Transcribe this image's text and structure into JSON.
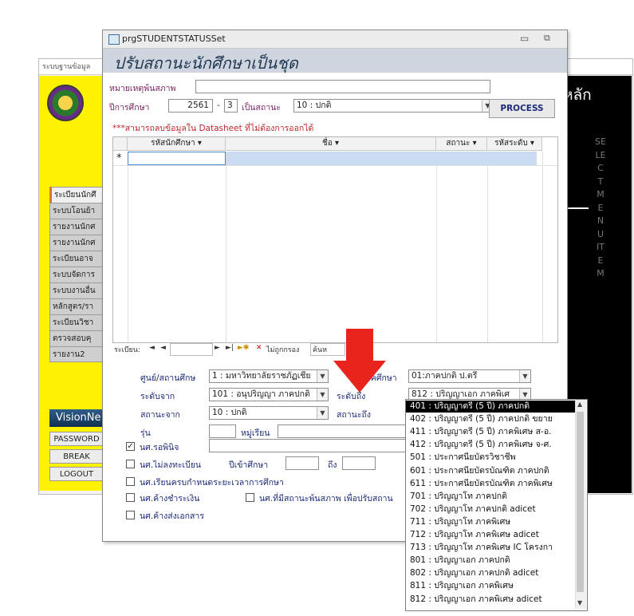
{
  "background_window": {
    "title": "ระบบฐานข้อมูล",
    "menu_items": [
      "ระเบียนนักศึ",
      "ระบบโอนย้า",
      "รายงานนักศ",
      "รายงานนักศ",
      "ระเบียนอาจ",
      "ระบบจัดการ",
      "ระบบงานอื่น",
      "หลักสูตร/รา",
      "ระเบียนวิชา",
      "ตรวจสอบคุ",
      "รายงาน2"
    ],
    "vision_label": "VisionNe",
    "buttons": {
      "password": "PASSWORD",
      "break": "BREAK",
      "logout": "LOGOUT"
    },
    "main_menu_title": "หลัก",
    "vertical_text": "SELECT MENU ITEM"
  },
  "form": {
    "window_title": "prgSTUDENTSTATUSSet",
    "header": "ปรับสถานะนักศึกษาเป็นชุด",
    "remark_label": "หมายเหตุพ้นสภาพ",
    "remark_value": "",
    "year_label": "ปีการศึกษา",
    "year_value": "2561",
    "year_sep": "-",
    "term_value": "3",
    "status_to_label": "เป็นสถานะ",
    "status_to_value": "10 : ปกติ",
    "process_label": "PROCESS",
    "warning": "***สามารถลบข้อมูลใน Datasheet ที่ไม่ต้องการออกได้"
  },
  "datasheet": {
    "columns": [
      "รหัสนักศึกษา",
      "ชื่อ",
      "สถานะ",
      "รหัสระดับ"
    ],
    "new_row_marker": "*"
  },
  "navbar": {
    "record_label": "ระเบียน:",
    "first": "◄",
    "prev": "◄",
    "next": "►",
    "last": "►|",
    "new": "►✱",
    "filter_label": "ไม่ถูกกรอง",
    "search_label": "ค้นห"
  },
  "filters": {
    "center_label": "ศูนย์/สถานศึกษ",
    "center_value": "1 : มหาวิทยาลัยราชภัฏเชีย",
    "study_type_label": "ภาคศึกษา",
    "study_type_value": "01:ภาคปกติ ป.ตรี",
    "level_from_label": "ระดับจาก",
    "level_from_value": "101 : อนุปริญญา ภาคปกติ",
    "level_to_label": "ระดับถึง",
    "level_to_value": "812 : ปริญญาเอก ภาคพิเศ",
    "status_from_label": "สถานะจาก",
    "status_from_value": "10 : ปกติ",
    "status_to_label": "สถานะถึง",
    "batch_label": "รุ่น",
    "batch_value": "",
    "group_label": "หมู่เรียน",
    "group_value": "",
    "chk_retire": "นศ.รอพินิจ",
    "chk_not_registered": "นศ.ไม่ลงทะเบียน",
    "entry_year_label": "ปีเข้าศึกษา",
    "to_label": "ถึง",
    "chk_full_period": "นศ.เรียนครบกำหนดระยะเวลาการศึกษา",
    "chk_unpaid": "นศ.ค้างชำระเงิน",
    "chk_status_out": "นศ.ที่มีสถานะพ้นสภาพ เพื่อปรับสถาน",
    "chk_docs": "นศ.ค้างส่งเอกสาร"
  },
  "dropdown_list": {
    "items": [
      "401 : ปริญญาตรี (5 ปี) ภาคปกติ",
      "402 : ปริญญาตรี (5 ปี) ภาคปกติ ขยาย",
      "411 : ปริญญาตรี (5 ปี) ภาคพิเศษ ส-อ.",
      "412 : ปริญญาตรี (5 ปี) ภาคพิเศษ จ-ศ.",
      "501 : ประกาศนียบัตรวิชาชีพ",
      "601 : ประกาศนียบัตรบัณฑิต ภาคปกติ",
      "611 : ประกาศนียบัตรบัณฑิต ภาคพิเศษ",
      "701 : ปริญญาโท ภาคปกติ",
      "702 : ปริญญาโท ภาคปกติ adicet",
      "711 : ปริญญาโท ภาคพิเศษ",
      "712 : ปริญญาโท ภาคพิเศษ adicet",
      "713 : ปริญญาโท ภาคพิเศษ IC โครงกา",
      "801 : ปริญญาเอก ภาคปกติ",
      "802 : ปริญญาเอก ภาคปกติ adicet",
      "811 : ปริญญาเอก ภาคพิเศษ",
      "812 : ปริญญาเอก ภาคพิเศษ adicet"
    ],
    "selected_index": 0
  },
  "colors": {
    "arrow": "#e8241c",
    "header_bg": "#cfd5df",
    "label": "#1d2b78",
    "warning": "#c0272d"
  }
}
